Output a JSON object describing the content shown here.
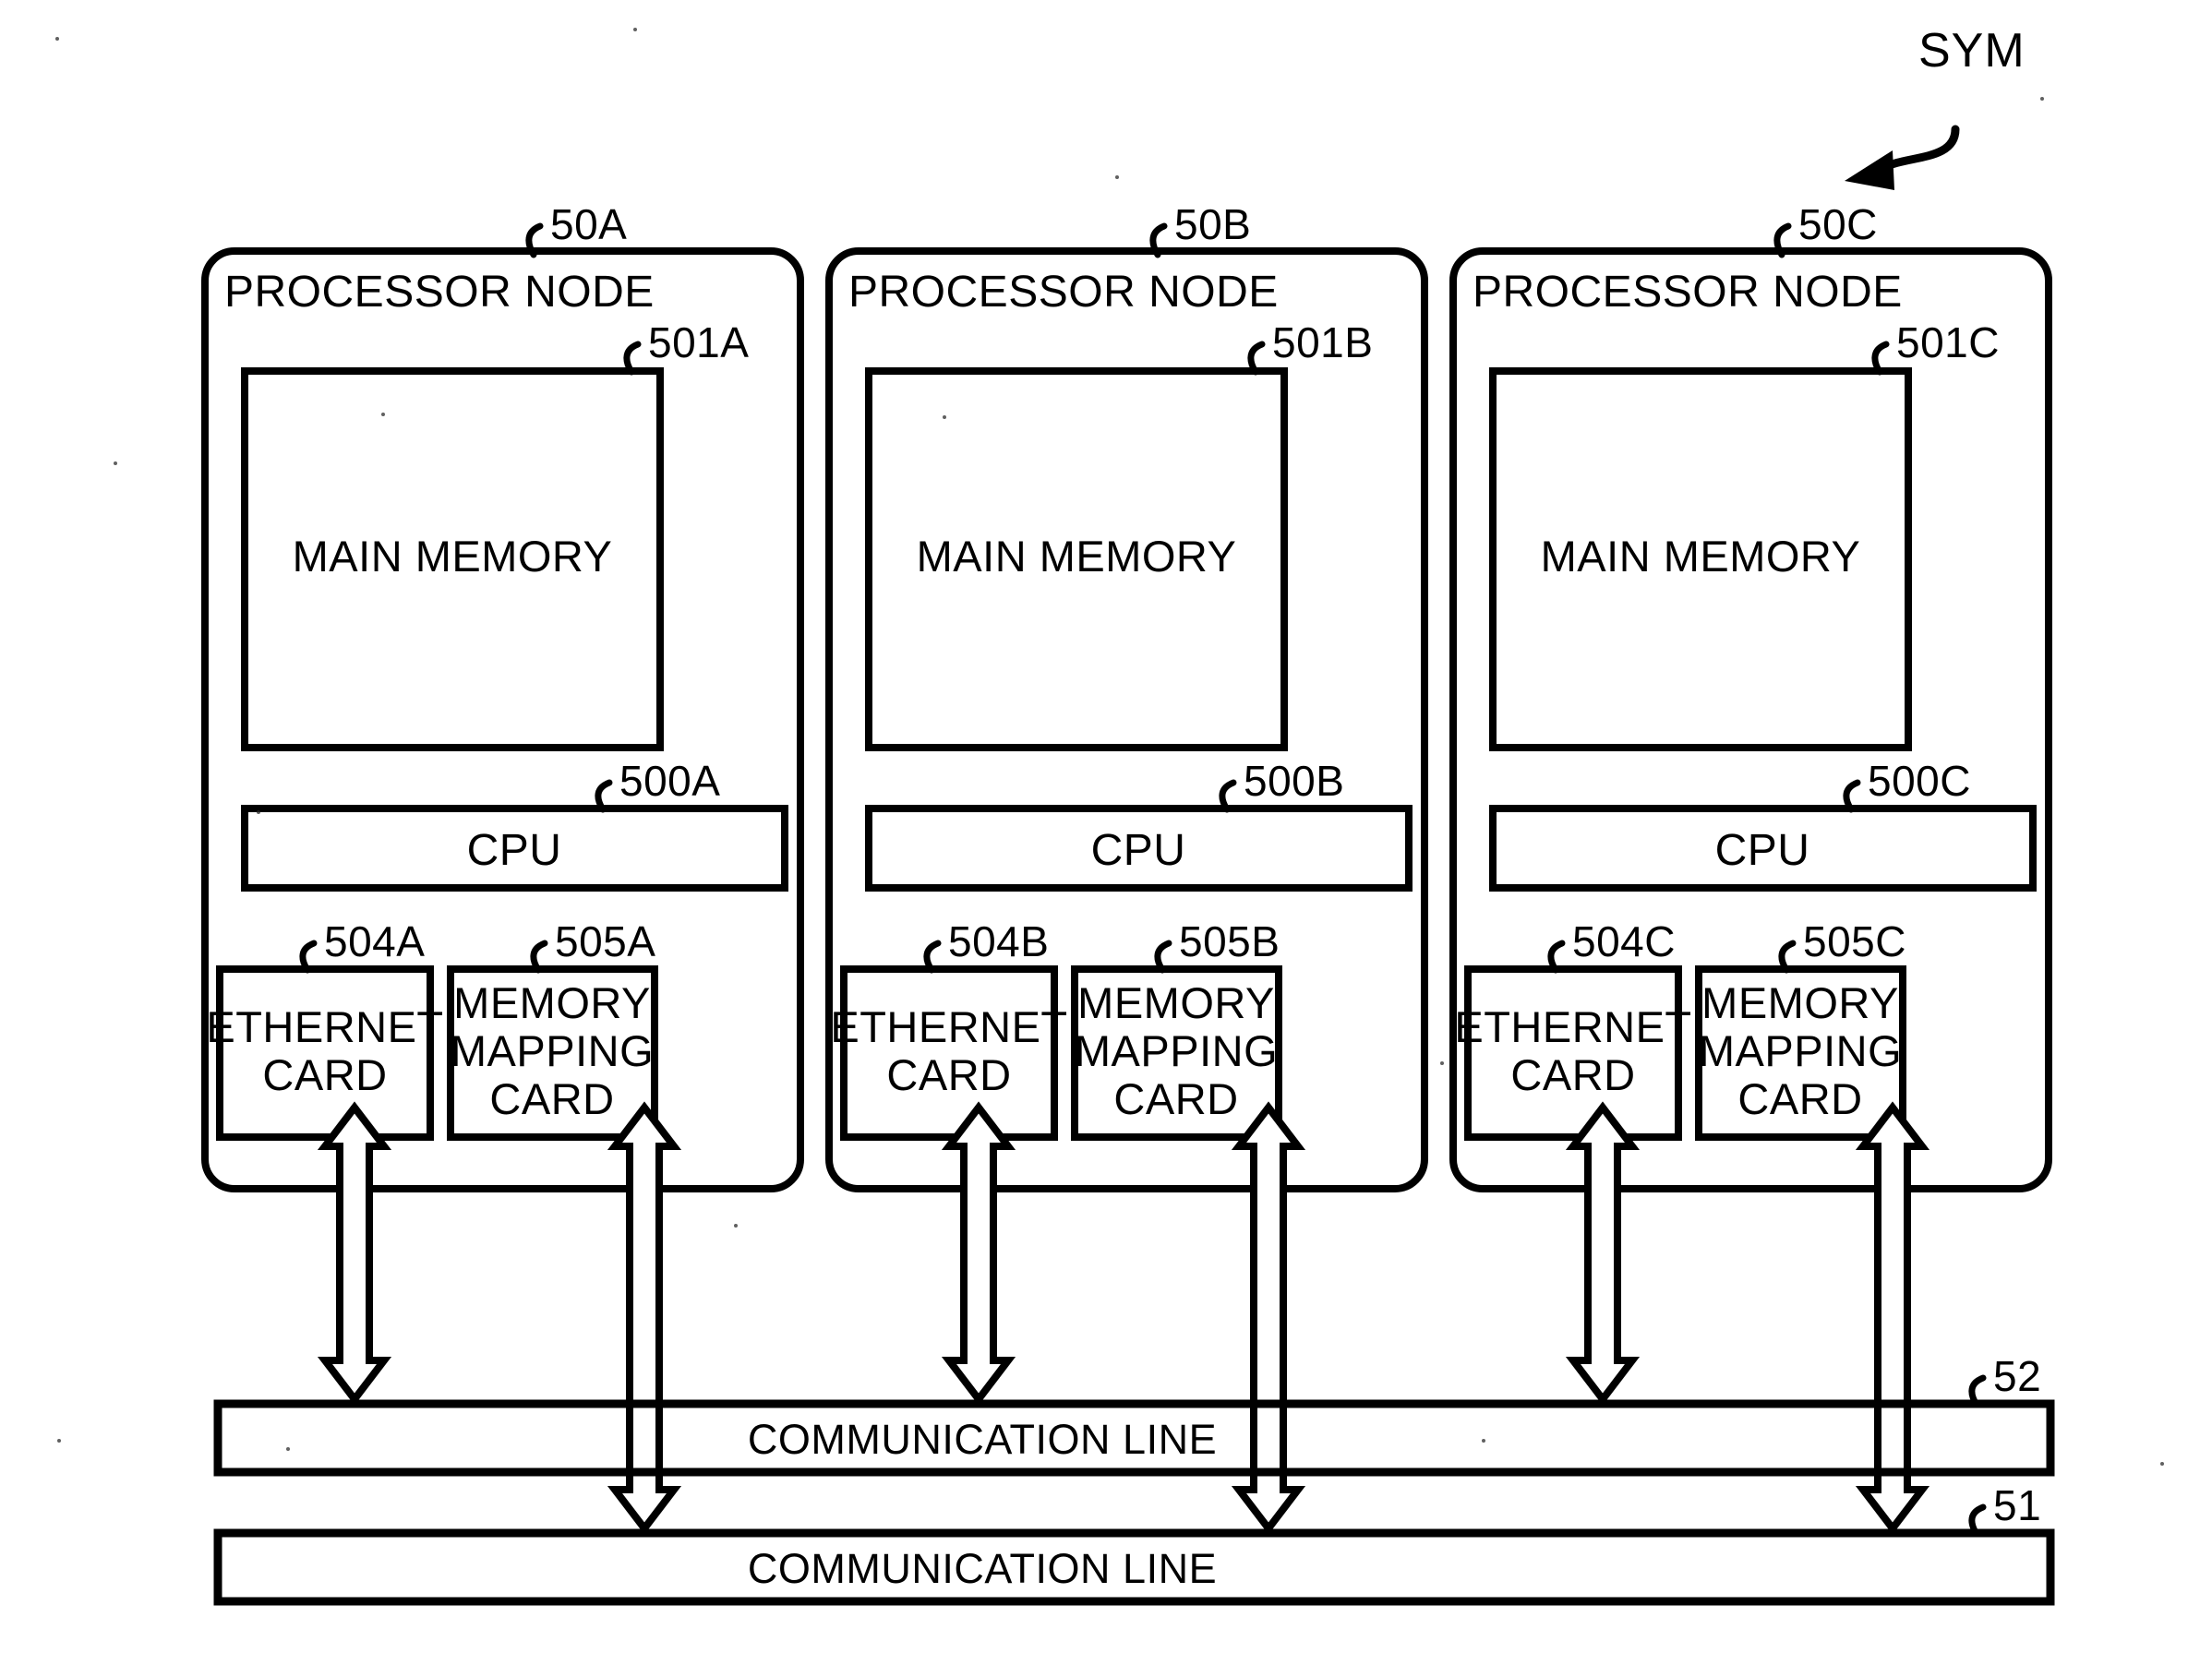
{
  "figure": {
    "system_label": "SYM",
    "arrow_icon": "curved-arrow-down-left"
  },
  "nodes": [
    {
      "id": "A",
      "ref": "50A",
      "title": "PROCESSOR NODE",
      "main_memory": {
        "ref": "501A",
        "label": "MAIN MEMORY"
      },
      "cpu": {
        "ref": "500A",
        "label": "CPU"
      },
      "ethernet_card": {
        "ref": "504A",
        "label": "ETHERNET\nCARD",
        "line1": "ETHERNET",
        "line2": "CARD"
      },
      "memory_mapping_card": {
        "ref": "505A",
        "label": "MEMORY MAPPING CARD",
        "line1": "MEMORY",
        "line2": "MAPPING",
        "line3": "CARD"
      }
    },
    {
      "id": "B",
      "ref": "50B",
      "title": "PROCESSOR NODE",
      "main_memory": {
        "ref": "501B",
        "label": "MAIN MEMORY"
      },
      "cpu": {
        "ref": "500B",
        "label": "CPU"
      },
      "ethernet_card": {
        "ref": "504B",
        "label": "ETHERNET\nCARD",
        "line1": "ETHERNET",
        "line2": "CARD"
      },
      "memory_mapping_card": {
        "ref": "505B",
        "label": "MEMORY MAPPING CARD",
        "line1": "MEMORY",
        "line2": "MAPPING",
        "line3": "CARD"
      }
    },
    {
      "id": "C",
      "ref": "50C",
      "title": "PROCESSOR NODE",
      "main_memory": {
        "ref": "501C",
        "label": "MAIN MEMORY"
      },
      "cpu": {
        "ref": "500C",
        "label": "CPU"
      },
      "ethernet_card": {
        "ref": "504C",
        "label": "ETHERNET\nCARD",
        "line1": "ETHERNET",
        "line2": "CARD"
      },
      "memory_mapping_card": {
        "ref": "505C",
        "label": "MEMORY MAPPING CARD",
        "line1": "MEMORY",
        "line2": "MAPPING",
        "line3": "CARD"
      }
    }
  ],
  "buses": [
    {
      "ref": "52",
      "label": "COMMUNICATION LINE",
      "position": "upper"
    },
    {
      "ref": "51",
      "label": "COMMUNICATION LINE",
      "position": "lower"
    }
  ],
  "colors": {
    "stroke": "#000000",
    "background": "#ffffff"
  }
}
